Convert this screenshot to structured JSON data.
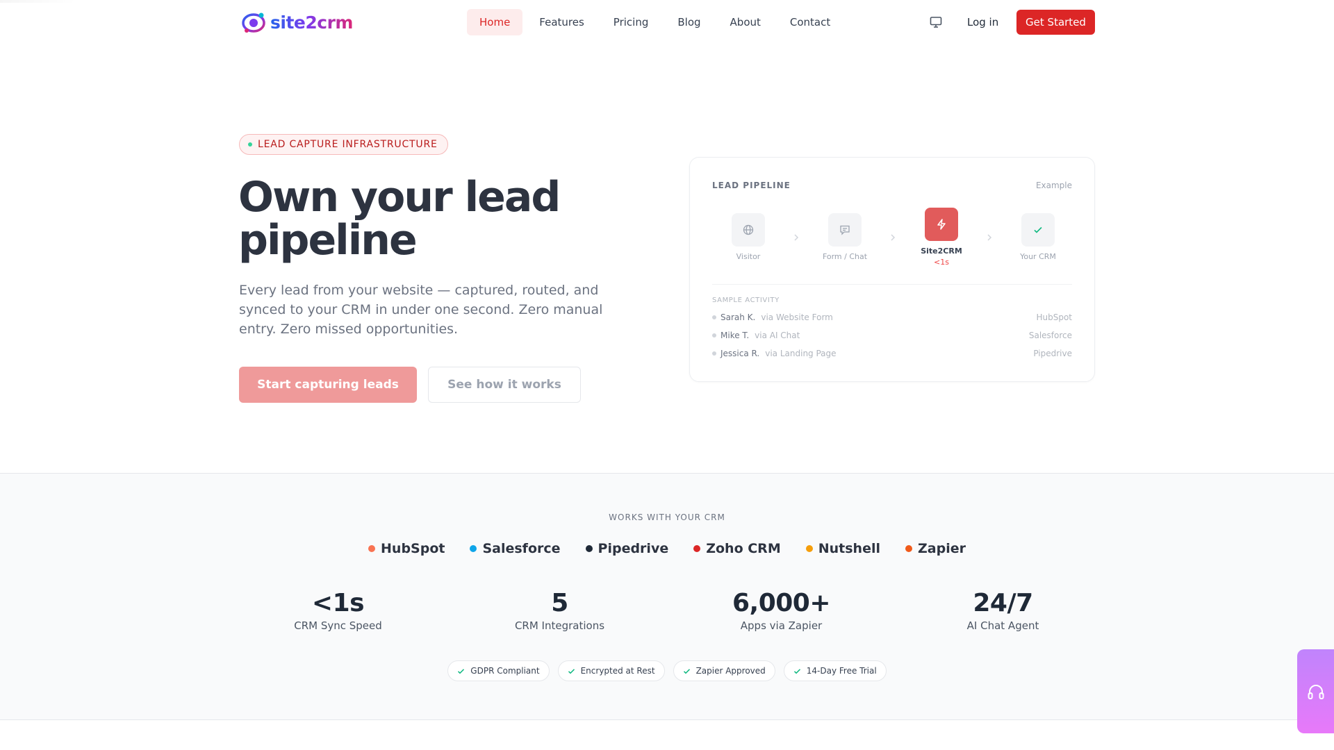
{
  "brand": {
    "name": "site2crm"
  },
  "nav": {
    "links": [
      {
        "label": "Home",
        "active": true
      },
      {
        "label": "Features"
      },
      {
        "label": "Pricing"
      },
      {
        "label": "Blog"
      },
      {
        "label": "About"
      },
      {
        "label": "Contact"
      }
    ],
    "login_label": "Log in",
    "cta_label": "Get Started",
    "theme_icon": "monitor-icon"
  },
  "hero": {
    "badge": "LEAD CAPTURE INFRASTRUCTURE",
    "title": "Own your lead pipeline",
    "subtitle": "Every lead from your website — captured, routed, and synced to your CRM in under one second. Zero manual entry. Zero missed opportunities.",
    "primary_cta": "Start capturing leads",
    "secondary_cta": "See how it works"
  },
  "pipeline_card": {
    "title": "LEAD PIPELINE",
    "tag": "Example",
    "steps": [
      {
        "label": "Visitor",
        "icon": "globe-icon"
      },
      {
        "label": "Form / Chat",
        "icon": "chat-icon"
      },
      {
        "label": "Site2CRM",
        "icon": "lightning-icon",
        "time": "<1s"
      },
      {
        "label": "Your CRM",
        "icon": "check-icon"
      }
    ],
    "activity_title": "SAMPLE ACTIVITY",
    "activity": [
      {
        "name": "Sarah K.",
        "via": "via Website Form",
        "crm": "HubSpot"
      },
      {
        "name": "Mike T.",
        "via": "via AI Chat",
        "crm": "Salesforce"
      },
      {
        "name": "Jessica R.",
        "via": "via Landing Page",
        "crm": "Pipedrive"
      }
    ]
  },
  "trust": {
    "heading": "WORKS WITH YOUR CRM",
    "crms": [
      {
        "name": "HubSpot",
        "color": "#f97352"
      },
      {
        "name": "Salesforce",
        "color": "#0ea5e9"
      },
      {
        "name": "Pipedrive",
        "color": "#1f2937"
      },
      {
        "name": "Zoho CRM",
        "color": "#dc2626"
      },
      {
        "name": "Nutshell",
        "color": "#f59e0b"
      },
      {
        "name": "Zapier",
        "color": "#f05a1a"
      }
    ],
    "stats": [
      {
        "value": "<1s",
        "label": "CRM Sync Speed"
      },
      {
        "value": "5",
        "label": "CRM Integrations"
      },
      {
        "value": "6,000+",
        "label": "Apps via Zapier"
      },
      {
        "value": "24/7",
        "label": "AI Chat Agent"
      }
    ],
    "badges": [
      "GDPR Compliant",
      "Encrypted at Rest",
      "Zapier Approved",
      "14-Day Free Trial"
    ]
  },
  "colors": {
    "accent": "#dc2626",
    "accent_soft": "#ef9a9a",
    "support_widget": "#d08cf9"
  },
  "support_widget_icon": "headset-icon"
}
